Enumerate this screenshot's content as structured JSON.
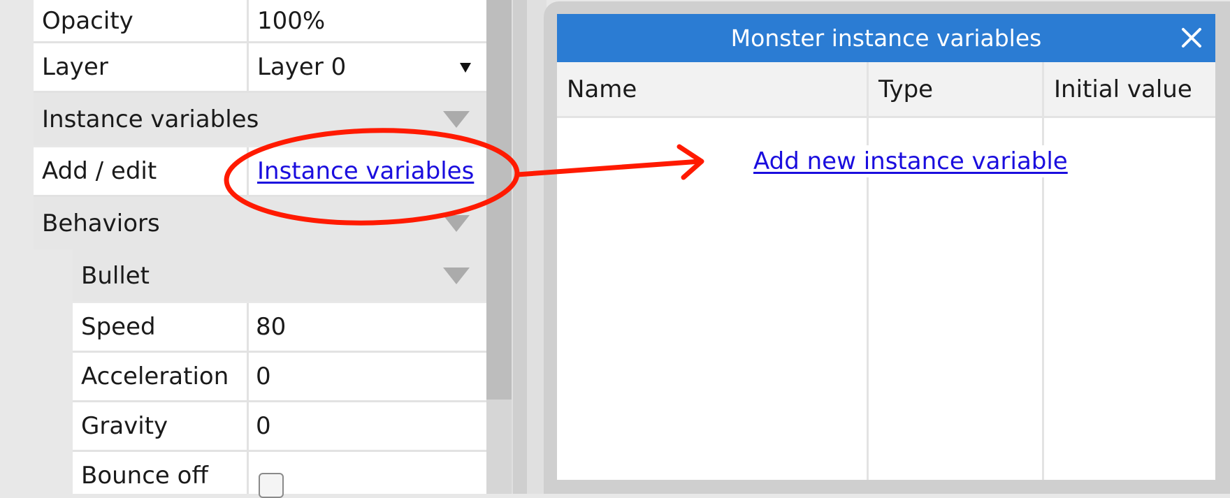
{
  "properties": {
    "opacity": {
      "label": "Opacity",
      "value": "100%"
    },
    "layer": {
      "label": "Layer",
      "value": "Layer 0"
    },
    "instance_variables_section": {
      "label": "Instance variables"
    },
    "add_edit": {
      "label": "Add / edit",
      "link": "Instance variables"
    },
    "behaviors_section": {
      "label": "Behaviors"
    },
    "bullet_section": {
      "label": "Bullet"
    },
    "speed": {
      "label": "Speed",
      "value": "80"
    },
    "acceleration": {
      "label": "Acceleration",
      "value": "0"
    },
    "gravity": {
      "label": "Gravity",
      "value": "0"
    },
    "bounce_off": {
      "label": "Bounce off",
      "checked": false
    }
  },
  "dialog": {
    "title": "Monster instance variables",
    "columns": [
      "Name",
      "Type",
      "Initial value"
    ],
    "add_link": "Add new instance variable"
  },
  "annotation": {
    "color": "#ff1a00"
  },
  "colors": {
    "titlebar": "#2b7cd3",
    "link": "#1a0dde"
  }
}
